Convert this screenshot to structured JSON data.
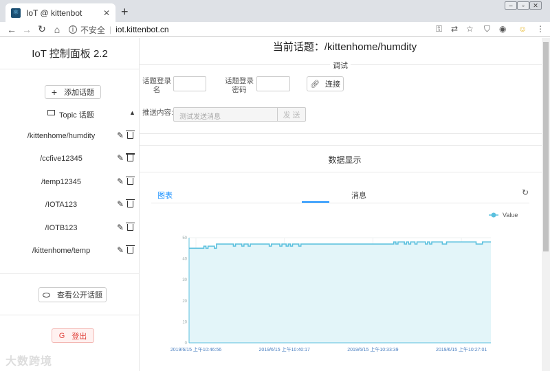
{
  "browser": {
    "tab_title": "IoT @ kittenbot",
    "tab_close": "✕",
    "new_tab": "+",
    "security_label": "不安全",
    "url": "iot.kittenbot.cn"
  },
  "sidebar": {
    "title": "IoT 控制面板 2.2",
    "add_topic_label": "添加话题",
    "topic_header_label": "Topic 话题",
    "topics": [
      {
        "name": "/kittenhome/humdity"
      },
      {
        "name": "/ccfive12345"
      },
      {
        "name": "/temp12345"
      },
      {
        "name": "/IOTA123"
      },
      {
        "name": "/IOTB123"
      },
      {
        "name": "/kittenhome/temp"
      }
    ],
    "public_topics_label": "查看公开话题",
    "logout_label": "登出"
  },
  "main": {
    "current_topic": "当前话题：/kittenhome/humdity",
    "debug_section_label": "调试",
    "login_name_label": "话题登录名",
    "login_password_label": "话题登录密码",
    "connect_label": "连接",
    "send_content_label": "推送内容:",
    "send_placeholder": "测试发送消息",
    "send_label": "发 送",
    "data_section_label": "数据显示",
    "tab_chart": "图表",
    "tab_message": "消息"
  },
  "watermark": "大数跨境",
  "colors": {
    "accent": "#1890ff",
    "line": "#5bc0de",
    "area": "#e3f5f9",
    "logout": "#e0413a"
  },
  "chart_data": {
    "type": "area",
    "legend": [
      "Value"
    ],
    "legend_position": "top-right",
    "ylim": [
      0,
      50
    ],
    "y_ticks": [
      0,
      10,
      20,
      30,
      40,
      50
    ],
    "x_tick_labels": [
      "2019/6/15 上午10:46:56",
      "2019/6/15 上午10:40:17",
      "2019/6/15 上午10:33:39",
      "2019/6/15 上午10:27:01"
    ],
    "grid": true,
    "series": [
      {
        "name": "Value",
        "values": [
          45,
          45,
          45,
          45,
          45,
          45,
          45,
          46,
          45,
          46,
          46,
          46,
          45,
          47,
          47,
          47,
          47,
          47,
          47,
          47,
          47,
          46,
          47,
          47,
          47,
          46,
          47,
          47,
          46,
          47,
          47,
          47,
          47,
          47,
          47,
          47,
          47,
          47,
          46,
          47,
          47,
          47,
          47,
          46,
          47,
          47,
          46,
          47,
          46,
          47,
          47,
          47,
          46,
          47,
          47,
          47,
          47,
          47,
          47,
          47,
          47,
          47,
          47,
          47,
          47,
          47,
          47,
          47,
          47,
          47,
          47,
          47,
          47,
          47,
          47,
          47,
          47,
          47,
          47,
          47,
          47,
          47,
          47,
          47,
          47,
          47,
          47,
          47,
          47,
          47,
          47,
          47,
          47,
          47,
          47,
          47,
          47,
          48,
          47,
          48,
          48,
          48,
          47,
          48,
          47,
          48,
          48,
          47,
          48,
          48,
          48,
          48,
          47,
          48,
          47,
          48,
          48,
          48,
          48,
          48,
          47,
          47,
          48,
          48,
          48,
          48,
          48,
          48,
          48,
          48,
          48,
          48,
          48,
          48,
          48,
          48,
          47,
          47,
          47,
          48,
          48,
          48,
          48,
          48
        ]
      }
    ]
  }
}
